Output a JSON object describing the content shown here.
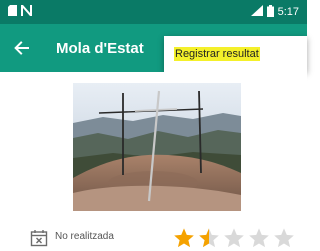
{
  "status_bar": {
    "time": "5:17",
    "bg_color": "#0a7a66",
    "icons": [
      "sim-icon",
      "notification-icon",
      "signal-icon",
      "battery-icon"
    ]
  },
  "app_bar": {
    "title": "Mola d'Estat",
    "back_icon": "arrow-left-icon",
    "bg_color": "#119a80"
  },
  "overflow_menu": {
    "items": [
      {
        "label": "Registrar resultat",
        "highlight_color": "#f4f02a"
      }
    ]
  },
  "summit_photo": {
    "description_icon": "summit-cross-photo"
  },
  "route_status": {
    "label": "No realitzada",
    "icon": "calendar-x-icon"
  },
  "rating": {
    "value": 1.5,
    "max": 5,
    "filled_color": "#f5a200",
    "empty_color": "#d9d9d9"
  }
}
